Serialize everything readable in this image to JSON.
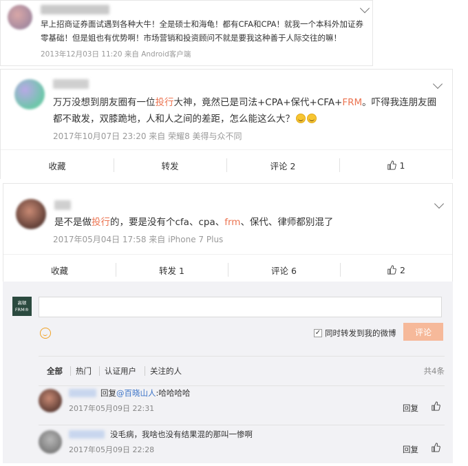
{
  "post1": {
    "text_line1": "早上招商证券面试遇到各种大牛！全是硕士和海龟！都有CFA和CPA！就我一个本科外加证券",
    "text_line2": "零基础！但是姐也有优势啊！市场营销和投资顾问不就是要我这种善于人际交往的嘛！",
    "meta": "2013年12月03日 11:20 来自 Android客户端"
  },
  "post2": {
    "text_a": "万万没想到朋友圈有一位",
    "text_hl1": "投行",
    "text_b": "大神，竟然已是司法+CPA+保代+CFA+",
    "text_hl2": "FRM",
    "text_c": "。吓得我连朋友圈",
    "text_line2": "都不敢发，双膝跪地，人和人之间的差距，怎么能这么大？",
    "meta": "2017年10月07日 23:20 来自 荣耀8 美得与众不同",
    "actions": {
      "fav": "收藏",
      "forward": "转发",
      "comment": "评论 2",
      "like": "1"
    }
  },
  "post3": {
    "text_a": "是不是做",
    "text_hl1": "投行",
    "text_b": "的，要是没有个cfa、cpa、",
    "text_hl2": "frm",
    "text_c": "、保代、律师都别混了",
    "meta": "2017年05月04日 17:58 来自 iPhone 7 Plus",
    "actions": {
      "fav": "收藏",
      "forward": "转发 1",
      "comment": "评论 6",
      "like": "2"
    }
  },
  "comment_box": {
    "logo_line1": "高顿",
    "logo_line2": "FRM®",
    "sync_checkbox_mark": "✓",
    "sync_forward_label": "同时转发到我的微博",
    "submit_label": "评论"
  },
  "filters": {
    "all": "全部",
    "hot": "热门",
    "verified": "认证用户",
    "following": "关注的人",
    "total": "共4条"
  },
  "sub_comments": [
    {
      "reply_prefix": "回复",
      "mention": "@百晓山人",
      "text": ":哈哈哈哈",
      "time": "2017年05月09日 22:31",
      "reply_label": "回复"
    },
    {
      "text": "没毛病，我啥也没有结果混的那叫一惨啊",
      "time": "2017年05月09日 22:28",
      "reply_label": "回复"
    }
  ]
}
